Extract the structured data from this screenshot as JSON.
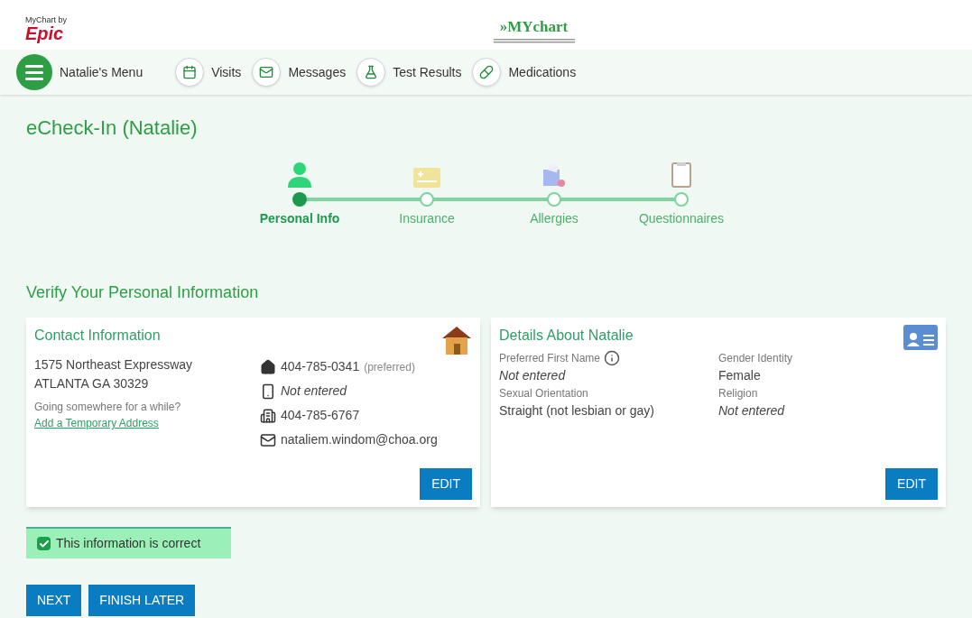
{
  "header": {
    "brand_small": "MyChart by",
    "brand": "Epic",
    "logo": "»MYchart"
  },
  "nav": [
    {
      "kind": "menu",
      "label": "Natalie's Menu"
    },
    {
      "kind": "calendar",
      "label": "Visits"
    },
    {
      "kind": "envelope",
      "label": "Messages"
    },
    {
      "kind": "flask",
      "label": "Test Results"
    },
    {
      "kind": "pills",
      "label": "Medications"
    }
  ],
  "page_title": "eCheck-In (Natalie)",
  "steps": [
    {
      "kind": "person",
      "label": "Personal Info",
      "selected": true
    },
    {
      "kind": "card",
      "label": "Insurance",
      "selected": false
    },
    {
      "kind": "allergy",
      "label": "Allergies",
      "selected": false
    },
    {
      "kind": "clipboard",
      "label": "Questionnaires",
      "selected": false
    }
  ],
  "section_title": "Verify Your Personal Information",
  "contact": {
    "title": "Contact Information",
    "address": [
      "1575 Northeast Expressway",
      "ATLANTA GA 30329"
    ],
    "prompt": "Going somewhere for a while?",
    "link": "Add a Temporary Address",
    "entries": [
      {
        "kind": "home",
        "value": "404-785-0341",
        "note": "(preferred)",
        "entered": true
      },
      {
        "kind": "mobile",
        "value": "Not entered",
        "entered": false
      },
      {
        "kind": "work",
        "value": "404-785-6767",
        "entered": true
      },
      {
        "kind": "email",
        "value": "nataliem.windom@choa.org",
        "entered": true
      }
    ],
    "button": "EDIT"
  },
  "details": {
    "title": "Details About Natalie",
    "fields": [
      {
        "label": "Preferred First Name",
        "value": "Not entered",
        "entered": false,
        "info": true
      },
      {
        "label": "Gender Identity",
        "value": "Female",
        "entered": true,
        "info": false
      },
      {
        "label": "Sexual Orientation",
        "value": "Straight (not lesbian or gay)",
        "entered": true,
        "info": false
      },
      {
        "label": "Religion",
        "value": "Not entered",
        "entered": false,
        "info": false
      }
    ],
    "button": "EDIT"
  },
  "confirm": {
    "label": "This information is correct",
    "checked": true
  },
  "buttons": [
    "NEXT",
    "FINISH LATER"
  ]
}
